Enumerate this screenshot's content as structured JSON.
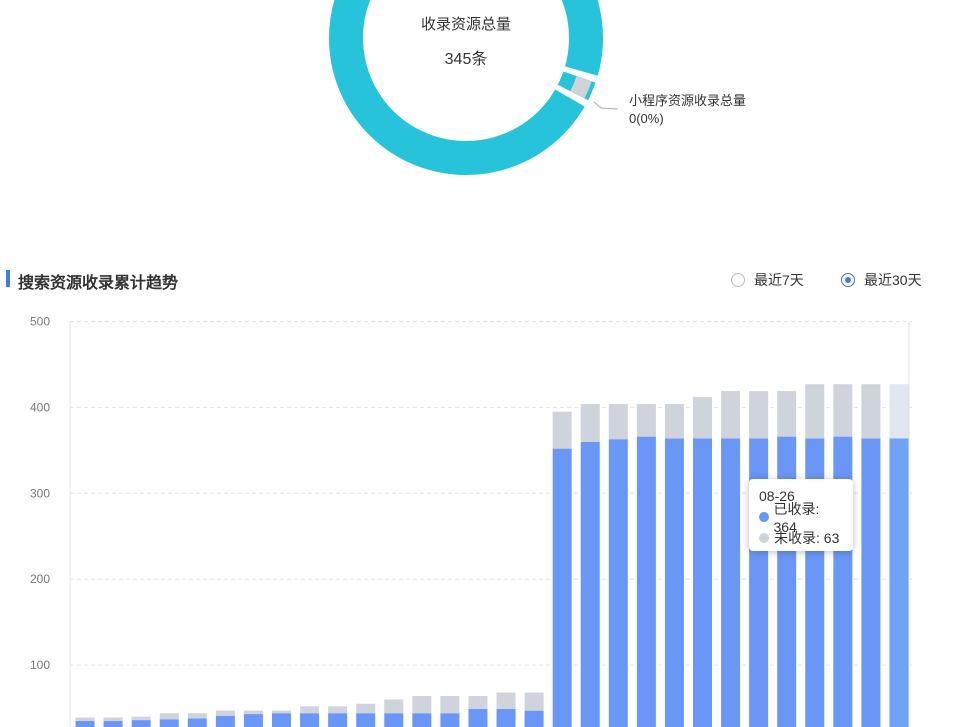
{
  "donut": {
    "center_title": "收录资源总量",
    "center_value": "345条",
    "label_name": "小程序资源收录总量",
    "label_value": "0(0%)",
    "colors": {
      "main": "#26c3da",
      "minor": "#cfd2d8",
      "leader": "#aaaaaa"
    }
  },
  "trend": {
    "title": "搜索资源收录累计趋势",
    "range_options": [
      {
        "label": "最近7天",
        "selected": false
      },
      {
        "label": "最近30天",
        "selected": true
      }
    ],
    "accent_color": "#3f7fe0"
  },
  "tooltip": {
    "date": "08-26",
    "rows": [
      {
        "label": "已收录: 364",
        "color": "#6a96f5"
      },
      {
        "label": "未收录: 63",
        "color": "#cfd3dc"
      }
    ]
  },
  "chart_data": {
    "type": "bar",
    "stacked": true,
    "title": "搜索资源收录累计趋势",
    "xlabel": "",
    "ylabel": "",
    "ylim": [
      0,
      500
    ],
    "y_ticks": [
      100,
      200,
      300,
      400,
      500
    ],
    "grid": true,
    "series": [
      {
        "name": "已收录",
        "color": "#6a96f5",
        "values": [
          35,
          35,
          36,
          37,
          38,
          41,
          43,
          44,
          44,
          44,
          44,
          44,
          44,
          44,
          49,
          49,
          47,
          352,
          360,
          363,
          366,
          364,
          364,
          364,
          364,
          366,
          364,
          366,
          364,
          364
        ]
      },
      {
        "name": "未收录",
        "color": "#cfd3dc",
        "values": [
          4,
          4,
          4,
          7,
          6,
          6,
          4,
          3,
          8,
          8,
          11,
          16,
          20,
          20,
          15,
          19,
          21,
          43,
          44,
          41,
          38,
          40,
          48,
          55,
          55,
          53,
          63,
          61,
          63,
          63
        ]
      }
    ],
    "highlight_index": 29
  }
}
